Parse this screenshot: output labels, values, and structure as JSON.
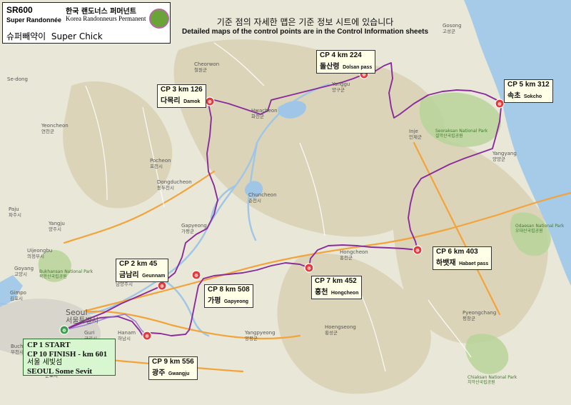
{
  "title": {
    "code": "SR600",
    "subtitle": "Super Randonnée",
    "org_ko": "한국 랜도너스 퍼머넌트",
    "org_en": "Korea Randonneurs Permanent",
    "route_name_ko": "슈퍼빼약이",
    "route_name_en": "Super Chick"
  },
  "note": {
    "ko": "기준 점의 자세한 맵은 기준 정보 시트에 있습니다",
    "en": "Detailed maps of the control points are in the Control Information sheets"
  },
  "controls": [
    {
      "id": "cp1",
      "line1": "CP  1  START",
      "line2": "CP 10 FINISH - km 601",
      "ko": "서울 세빛섬",
      "en": "SEOUL Some Sevit"
    },
    {
      "id": "cp2",
      "num": "CP 2   km 45",
      "ko": "금남리",
      "en": "Geunnam"
    },
    {
      "id": "cp3",
      "num": "CP 3   km 126",
      "ko": "다목리",
      "en": "Damok"
    },
    {
      "id": "cp4",
      "num": "CP 4   km 224",
      "ko": "돌산령",
      "en": "Dolsan pass"
    },
    {
      "id": "cp5",
      "num": "CP 5   km 312",
      "ko": "속초",
      "en": "Sokcho"
    },
    {
      "id": "cp6",
      "num": "CP 6   km 403",
      "ko": "하뱃재",
      "en": "Habaet pass"
    },
    {
      "id": "cp7",
      "num": "CP 7   km 452",
      "ko": "홍천",
      "en": "Hongcheon"
    },
    {
      "id": "cp8",
      "num": "CP 8   km 508",
      "ko": "가평",
      "en": "Gapyeong"
    },
    {
      "id": "cp9",
      "num": "CP 9   km 556",
      "ko": "광주",
      "en": "Gwangju"
    }
  ],
  "places": [
    {
      "en": "Gosong",
      "ko": "고성군"
    },
    {
      "en": "Cheorwon",
      "ko": "철원군"
    },
    {
      "en": "Yanggu",
      "ko": "양구군"
    },
    {
      "en": "Hwacheon",
      "ko": "화천군"
    },
    {
      "en": "Inje",
      "ko": "인제군"
    },
    {
      "en": "Sokcho",
      "ko": "속초시"
    },
    {
      "en": "Yangyang",
      "ko": "양양군"
    },
    {
      "en": "Yeoncheon",
      "ko": "연천군"
    },
    {
      "en": "Pocheon",
      "ko": "포천시"
    },
    {
      "en": "Dongducheon",
      "ko": "동두천시"
    },
    {
      "en": "Chuncheon",
      "ko": "춘천시"
    },
    {
      "en": "Gapyeong",
      "ko": "가평군"
    },
    {
      "en": "Yangju",
      "ko": "양주시"
    },
    {
      "en": "Uijeongbu",
      "ko": "의정부시"
    },
    {
      "en": "Namyangju",
      "ko": "남양주시"
    },
    {
      "en": "Hongcheon",
      "ko": "홍천군"
    },
    {
      "en": "Seoul",
      "ko": "서울특별시"
    },
    {
      "en": "Guri",
      "ko": "구리시"
    },
    {
      "en": "Hanam",
      "ko": "하남시"
    },
    {
      "en": "Yangpyeong",
      "ko": "양평군"
    },
    {
      "en": "Hoengseong",
      "ko": "횡성군"
    },
    {
      "en": "Pyeongchang",
      "ko": "평창군"
    },
    {
      "en": "Goyang",
      "ko": "고양시"
    },
    {
      "en": "Paju",
      "ko": "파주시"
    },
    {
      "en": "Gimpo",
      "ko": "김포시"
    },
    {
      "en": "Bucheon",
      "ko": "부천시"
    },
    {
      "en": "Gunpo",
      "ko": "군포시"
    },
    {
      "en": "Se-dong",
      "ko": ""
    }
  ],
  "parks": [
    {
      "en": "Seoraksan National Park",
      "ko": "설악산국립공원"
    },
    {
      "en": "Odaesan National Park",
      "ko": "오대산국립공원"
    },
    {
      "en": "Bukhansan National Park",
      "ko": "북한산국립공원"
    },
    {
      "en": "Chiaksan National Park",
      "ko": "치악산국립공원"
    }
  ],
  "colors": {
    "route": "#8a2b9c",
    "sea": "#a6cbe8",
    "land": "#e9e7d8",
    "mountain": "#d6cfb0",
    "park": "#b9d49a",
    "road_major": "#f2a43a",
    "road_minor": "#ffffff",
    "control_marker": "#e23a3a",
    "start_box": "#d8f7d0",
    "cp_box": "#ffffe8"
  }
}
